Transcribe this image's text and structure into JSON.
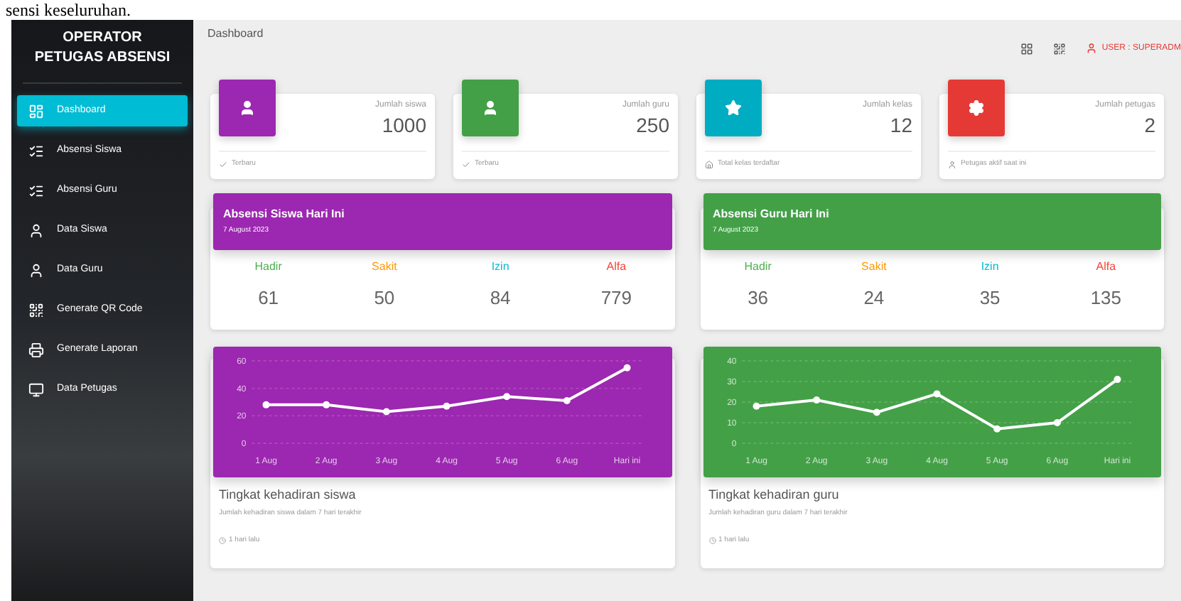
{
  "caption": "sensi keseluruhan.",
  "sidebar": {
    "title": "OPERATOR",
    "subtitle": "PETUGAS ABSENSI",
    "items": [
      {
        "label": "Dashboard",
        "selected": true
      },
      {
        "label": "Absensi Siswa",
        "selected": false
      },
      {
        "label": "Absensi Guru",
        "selected": false
      },
      {
        "label": "Data Siswa",
        "selected": false
      },
      {
        "label": "Data Guru",
        "selected": false
      },
      {
        "label": "Generate QR Code",
        "selected": false
      },
      {
        "label": "Generate Laporan",
        "selected": false
      },
      {
        "label": "Data Petugas",
        "selected": false
      }
    ]
  },
  "header": {
    "title": "Dashboard",
    "user": "USER : SUPERADM"
  },
  "stats": [
    {
      "color": "#9c27b0",
      "label": "Jumlah siswa",
      "value": "1000",
      "footer": "Terbaru"
    },
    {
      "color": "#43a047",
      "label": "Jumlah guru",
      "value": "250",
      "footer": "Terbaru"
    },
    {
      "color": "#00acc1",
      "label": "Jumlah kelas",
      "value": "12",
      "footer": "Total kelas terdaftar"
    },
    {
      "color": "#e53935",
      "label": "Jumlah petugas",
      "value": "2",
      "footer": "Petugas aktif saat ini"
    }
  ],
  "attendance": [
    {
      "title": "Absensi Siswa Hari Ini",
      "date": "7 August 2023",
      "color": "#9c27b0",
      "items": [
        {
          "label": "Hadir",
          "value": "61",
          "color": "#4caf50"
        },
        {
          "label": "Sakit",
          "value": "50",
          "color": "#ff9800"
        },
        {
          "label": "Izin",
          "value": "84",
          "color": "#00bcd4"
        },
        {
          "label": "Alfa",
          "value": "779",
          "color": "#f44336"
        }
      ]
    },
    {
      "title": "Absensi Guru Hari Ini",
      "date": "7 August 2023",
      "color": "#43a047",
      "items": [
        {
          "label": "Hadir",
          "value": "36",
          "color": "#4caf50"
        },
        {
          "label": "Sakit",
          "value": "24",
          "color": "#ff9800"
        },
        {
          "label": "Izin",
          "value": "35",
          "color": "#00bcd4"
        },
        {
          "label": "Alfa",
          "value": "135",
          "color": "#f44336"
        }
      ]
    }
  ],
  "charts": [
    {
      "color": "#9c27b0",
      "title": "Tingkat kehadiran siswa",
      "subtitle": "Jumlah kehadiran siswa dalam 7 hari terakhir",
      "footer": "1 hari lalu",
      "chart_data": {
        "type": "line",
        "grid": true,
        "categories": [
          "1 Aug",
          "2 Aug",
          "3 Aug",
          "4 Aug",
          "5 Aug",
          "6 Aug",
          "Hari ini"
        ],
        "ylim": [
          0,
          60
        ],
        "yticks": [
          0,
          20,
          40,
          60
        ],
        "series": [
          {
            "color": "#ffffff",
            "marker": true,
            "values": [
              28,
              28,
              23,
              27,
              34,
              31,
              55
            ]
          }
        ]
      }
    },
    {
      "color": "#43a047",
      "title": "Tingkat kehadiran guru",
      "subtitle": "Jumlah kehadiran guru dalam 7 hari terakhir",
      "footer": "1 hari lalu",
      "chart_data": {
        "type": "line",
        "grid": true,
        "categories": [
          "1 Aug",
          "2 Aug",
          "3 Aug",
          "4 Aug",
          "5 Aug",
          "6 Aug",
          "Hari ini"
        ],
        "ylim": [
          0,
          40
        ],
        "yticks": [
          0,
          10,
          20,
          30,
          40
        ],
        "series": [
          {
            "color": "#ffffff",
            "marker": true,
            "values": [
              18,
              21,
              15,
              24,
              7,
              10,
              31
            ]
          }
        ]
      }
    }
  ]
}
